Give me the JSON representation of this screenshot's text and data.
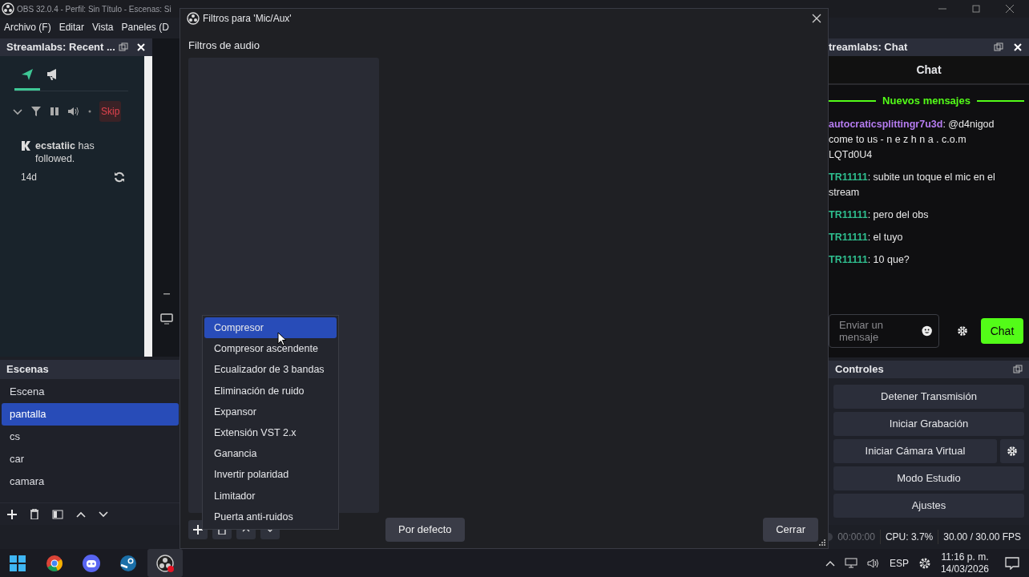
{
  "app": {
    "title": "OBS 32.0.4 - Perfil: Sin Título - Escenas: Si"
  },
  "menu": [
    "Archivo (F)",
    "Editar",
    "Vista",
    "Paneles (D"
  ],
  "recent_dock": {
    "title": "Streamlabs: Recent ...",
    "tabs": [
      {
        "kind": "send",
        "selected": true
      },
      {
        "kind": "megaphone",
        "selected": false
      }
    ],
    "skip_button": "Skip",
    "event": {
      "text": "**ecstatiic** has followed.",
      "time": "14d"
    }
  },
  "scenes": {
    "title": "Escenas",
    "items": [
      {
        "name": "Escena",
        "selected": false
      },
      {
        "name": "pantalla",
        "selected": true
      },
      {
        "name": "cs",
        "selected": false
      },
      {
        "name": "car",
        "selected": false
      },
      {
        "name": "camara",
        "selected": false
      }
    ]
  },
  "chat_dock": {
    "title": "treamlabs: Chat",
    "heading": "Chat",
    "divider": "Nuevos mensajes",
    "messages": [
      {
        "user": "autocraticsplittingr7u3d",
        "color": "#b57cf0",
        "text": ": @d4nigod come to us - n e z h n a . c.o.m LQTd0U4"
      },
      {
        "user": "TR11111",
        "color": "#2fbf8f",
        "text": ": subite un toque el mic en el stream"
      },
      {
        "user": "TR11111",
        "color": "#2fbf8f",
        "text": ": pero del obs"
      },
      {
        "user": "TR11111",
        "color": "#2fbf8f",
        "text": ": el tuyo"
      },
      {
        "user": "TR11111",
        "color": "#2fbf8f",
        "text": ": 10 que?"
      }
    ],
    "input": {
      "placeholder": "Enviar un mensaje"
    },
    "send_button": "Chat"
  },
  "controls": {
    "title": "Controles",
    "buttons": [
      {
        "label": "Detener Transmisión",
        "kind": "plain"
      },
      {
        "label": "Iniciar Grabación",
        "kind": "plain"
      },
      {
        "label": "Iniciar Cámara Virtual",
        "kind": "with_settings"
      },
      {
        "label": "Modo Estudio",
        "kind": "plain"
      },
      {
        "label": "Ajustes",
        "kind": "plain"
      }
    ]
  },
  "status_bar": {
    "time": "00:00:00",
    "cpu": "CPU: 3.7%",
    "fps": "30.00 / 30.00 FPS"
  },
  "dialog": {
    "title": "Filtros para 'Mic/Aux'",
    "section": "Filtros de audio",
    "default_button": "Por defecto",
    "close_button": "Cerrar"
  },
  "filter_menu": {
    "items": [
      {
        "label": "Compresor",
        "selected": true
      },
      {
        "label": "Compresor ascendente",
        "selected": false
      },
      {
        "label": "Ecualizador de 3 bandas",
        "selected": false
      },
      {
        "label": "Eliminación de ruido",
        "selected": false
      },
      {
        "label": "Expansor",
        "selected": false
      },
      {
        "label": "Extensión VST 2.x",
        "selected": false
      },
      {
        "label": "Ganancia",
        "selected": false
      },
      {
        "label": "Invertir polaridad",
        "selected": false
      },
      {
        "label": "Limitador",
        "selected": false
      },
      {
        "label": "Puerta anti-ruidos",
        "selected": false
      }
    ]
  },
  "taskbar": {
    "apps": [
      {
        "kind": "start",
        "selected": false
      },
      {
        "kind": "browser",
        "selected": false
      },
      {
        "kind": "chat",
        "selected": false
      },
      {
        "kind": "game",
        "selected": false
      },
      {
        "kind": "recorder",
        "selected": true
      }
    ],
    "language": "ESP",
    "time": "11:16 p. m.",
    "date": "14/03/2026"
  }
}
